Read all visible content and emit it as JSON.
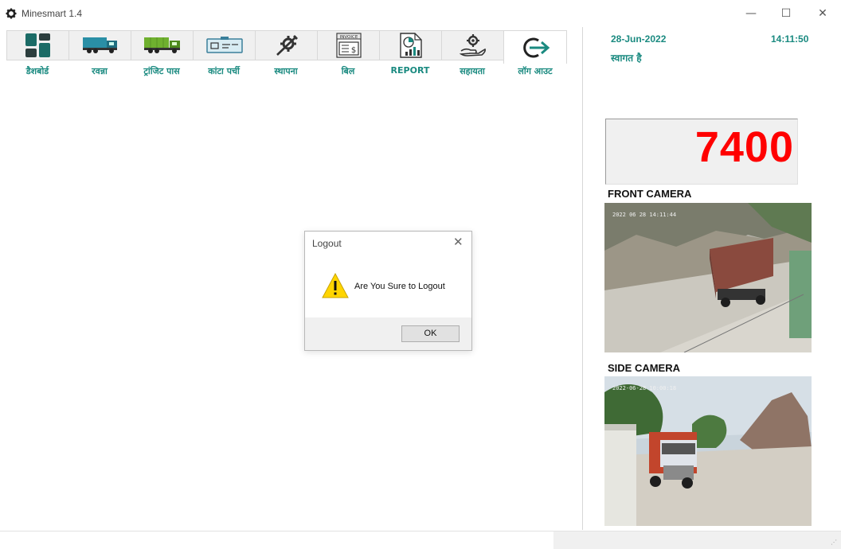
{
  "window": {
    "title": "Minesmart 1.4",
    "minimize_glyph": "—",
    "maximize_glyph": "☐",
    "close_glyph": "✕"
  },
  "nav": {
    "tabs": [
      {
        "label": "डैशबोर्ड",
        "icon": "dashboard-icon"
      },
      {
        "label": "रवन्ना",
        "icon": "truck-icon"
      },
      {
        "label": "ट्रांजिट पास",
        "icon": "transit-truck-icon"
      },
      {
        "label": "कांटा पर्ची",
        "icon": "weigh-slip-icon"
      },
      {
        "label": "स्थापना",
        "icon": "tools-icon"
      },
      {
        "label": "बिल",
        "icon": "invoice-icon"
      },
      {
        "label": "REPORT",
        "icon": "report-icon"
      },
      {
        "label": "सहायता",
        "icon": "help-hand-gear-icon"
      },
      {
        "label": "लॉग आउट",
        "icon": "logout-icon"
      }
    ],
    "invoice_icon_text": "INVOICE",
    "invoice_currency": "$",
    "selected_tab": "लॉग आउट",
    "accent_color": "#1a8a80"
  },
  "header": {
    "date": "28-Jun-2022",
    "time": "14:11:50",
    "welcome": "स्वागत है"
  },
  "weight": {
    "value": "7400",
    "color": "#ff0000"
  },
  "cameras": {
    "front": {
      "label": "FRONT CAMERA",
      "timestamp": "2022 06 28 14:11:44"
    },
    "side": {
      "label": "SIDE CAMERA",
      "timestamp": "2022-06-28 10:00:18"
    }
  },
  "dialog": {
    "title": "Logout",
    "close_glyph": "✕",
    "message": "Are You Sure to Logout",
    "ok_label": "OK",
    "icon": "warning-icon"
  }
}
